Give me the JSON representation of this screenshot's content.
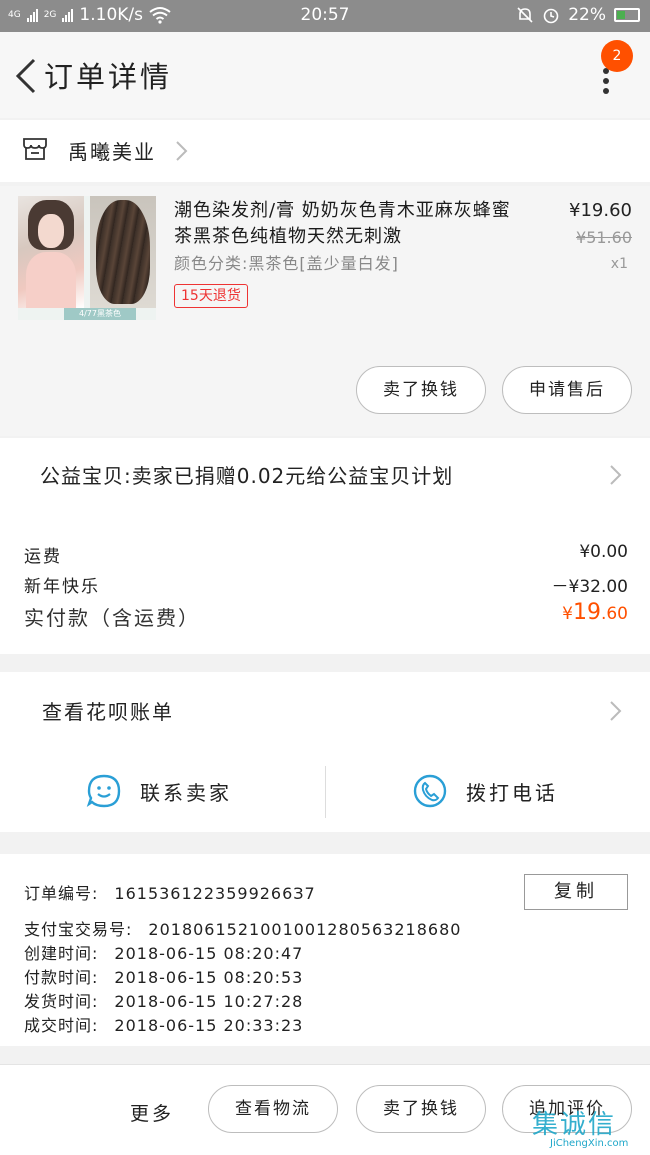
{
  "status_bar": {
    "network_left": "4G",
    "network_right": "2G",
    "speed": "1.10K/s",
    "time": "20:57",
    "battery": "22%",
    "colors": {
      "battery_fill": "#4caf50"
    }
  },
  "nav": {
    "title": "订单详情",
    "badge_count": "2",
    "icons": {
      "back": "chevron-left-icon",
      "more": "more-vertical-icon"
    },
    "badge_color": "#ff5000"
  },
  "store": {
    "name": "禹曦美业",
    "icon": "store-icon"
  },
  "item": {
    "title": "潮色染发剂/膏 奶奶灰色青木亚麻灰蜂蜜茶黑茶色纯植物天然无刺激",
    "sku": "颜色分类:黑茶色[盖少量白发]",
    "tag": "15天退货",
    "price": "¥19.60",
    "original_price": "¥51.60",
    "quantity": "x1",
    "thumb_caption": "4/77黑茶色",
    "buttons": {
      "sell": "卖了换钱",
      "after_sale": "申请售后"
    }
  },
  "charity": {
    "text": "公益宝贝:卖家已捐赠0.02元给公益宝贝计划"
  },
  "fees": {
    "shipping_label": "运费",
    "shipping_value": "¥0.00",
    "discount_label": "新年快乐",
    "discount_value": "－¥32.00",
    "total_label": "实付款（含运费）",
    "total_currency": "¥",
    "total_int": "19",
    "total_dec": ".60",
    "accent_color": "#ff5000"
  },
  "contact": {
    "bill_text": "查看花呗账单",
    "contact_seller": "联系卖家",
    "call_phone": "拨打电话",
    "icons": {
      "seller": "chat-bubble-icon",
      "phone": "phone-icon"
    },
    "icon_color": "#2a9fd6"
  },
  "order": {
    "number_label": "订单编号:",
    "number_value": "1615361223599266З7",
    "alipay_label": "支付宝交易号:",
    "alipay_value": "2018061521001001280563218680",
    "created_label": "创建时间:",
    "created_value": "2018-06-15 08:20:47",
    "paid_label": "付款时间:",
    "paid_value": "2018-06-15 08:20:53",
    "shipped_label": "发货时间:",
    "shipped_value": "2018-06-15 10:27:28",
    "completed_label": "成交时间:",
    "completed_value": "2018-06-15 20:33:23",
    "copy": "复制"
  },
  "bottom": {
    "more": "更多",
    "logistics": "查看物流",
    "sell": "卖了换钱",
    "review": "追加评价"
  },
  "watermark": {
    "cn": "集诚信",
    "en": "JiChengXin.com"
  }
}
